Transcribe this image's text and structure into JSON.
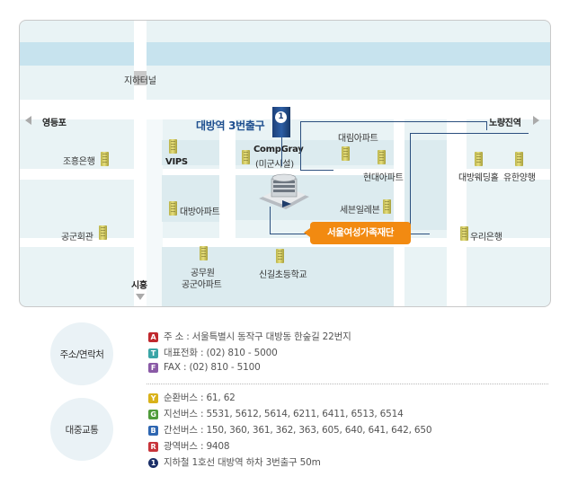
{
  "map": {
    "labels": {
      "tunnel": "지하터널",
      "yeongdeungpo": "영등포",
      "noryangjin": "노량진역",
      "siheung": "시흥",
      "daebang_exit": "대방역 3번출구",
      "exit_number": "1",
      "compgray": "CompGray",
      "compgray_sub": "(미군시설)",
      "daerim_apt": "대림아파트",
      "hyundai_apt": "현대아파트",
      "daebang_wedding": "대방웨딩홀",
      "yuhan": "유한양행",
      "chohung": "조흥은행",
      "vips": "VIPS",
      "daebang_apt": "대방아파트",
      "seven_eleven": "세븐일레븐",
      "foundation": "서울여성가족재단",
      "woori": "우리은행",
      "gonggun": "공군회관",
      "public_apt_1": "공무원",
      "public_apt_2": "공군아파트",
      "singil_school": "신길초등학교"
    }
  },
  "info": {
    "contact_title": "주소/연락처",
    "transit_title": "대중교통",
    "contact": [
      {
        "badge": "A",
        "color": "#c0282d",
        "text": "주 소 : 서울특별시 동작구 대방동 한숲길 22번지"
      },
      {
        "badge": "T",
        "color": "#3aa5a6",
        "text": "대표전화 : (02) 810 - 5000"
      },
      {
        "badge": "F",
        "color": "#8a5aa6",
        "text": "FAX : (02) 810 - 5100"
      }
    ],
    "transit": [
      {
        "badge": "Y",
        "color": "#d9b21a",
        "text": "순환버스 : 61, 62"
      },
      {
        "badge": "G",
        "color": "#4f9b3a",
        "text": "지선버스 : 5531, 5612, 5614, 6211, 6411, 6513, 6514"
      },
      {
        "badge": "B",
        "color": "#2e66b1",
        "text": "간선버스 : 150, 360, 361, 362, 363, 605, 640, 641, 642, 650"
      },
      {
        "badge": "R",
        "color": "#c8343a",
        "text": "광역버스 : 9408"
      },
      {
        "badge": "1",
        "color": "#1b2f68",
        "text": "지하철 1호선 대방역 하차 3번출구 50m"
      }
    ]
  }
}
